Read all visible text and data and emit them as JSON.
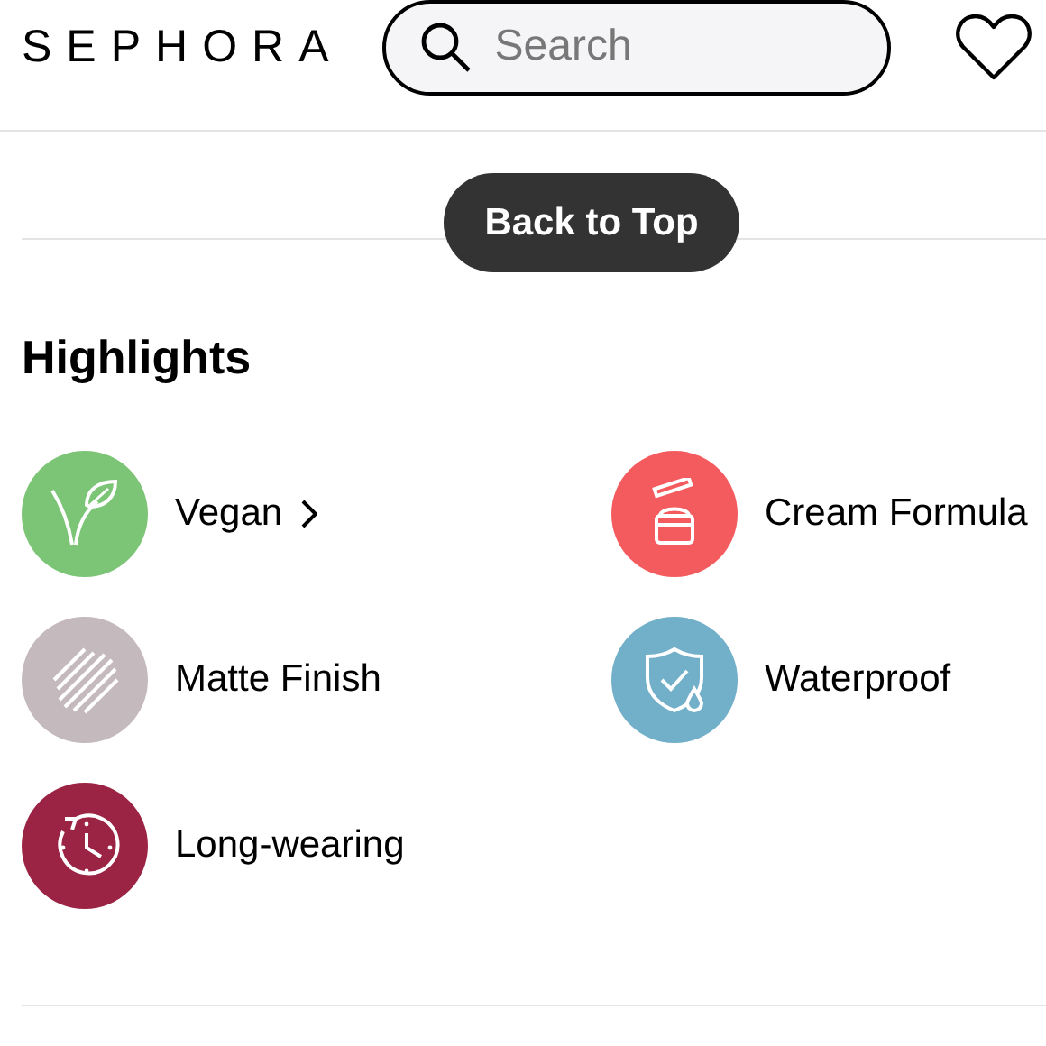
{
  "header": {
    "logo": "SEPHORA",
    "search": {
      "placeholder": "Search"
    }
  },
  "back_to_top": "Back to Top",
  "highlights": {
    "title": "Highlights",
    "items": [
      {
        "kind": "vegan",
        "label": "Vegan",
        "link": true,
        "color": "#7cc576"
      },
      {
        "kind": "cream",
        "label": "Cream Formula",
        "link": false,
        "color": "#f45b5e"
      },
      {
        "kind": "matte",
        "label": "Matte Finish",
        "link": false,
        "color": "#c4babd"
      },
      {
        "kind": "waterproof",
        "label": "Waterproof",
        "link": false,
        "color": "#72afc8"
      },
      {
        "kind": "longwear",
        "label": "Long-wearing",
        "link": false,
        "color": "#9b2444"
      }
    ]
  }
}
